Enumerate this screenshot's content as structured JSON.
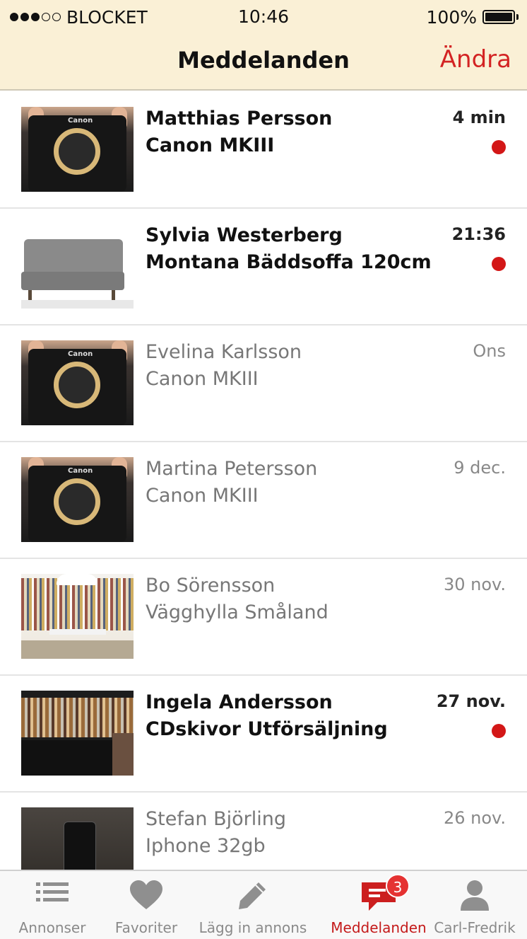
{
  "status_bar": {
    "carrier": "BLOCKET",
    "time": "10:46",
    "battery": "100%"
  },
  "nav": {
    "title": "Meddelanden",
    "edit_label": "Ändra"
  },
  "messages": [
    {
      "name": "Matthias Persson",
      "item": "Canon MKIII",
      "date": "4 min",
      "unread": true
    },
    {
      "name": "Sylvia Westerberg",
      "item": "Montana Bäddsoffa 120cm",
      "date": "21:36",
      "unread": true
    },
    {
      "name": "Evelina Karlsson",
      "item": "Canon MKIII",
      "date": "Ons",
      "unread": false
    },
    {
      "name": "Martina Petersson",
      "item": "Canon MKIII",
      "date": "9 dec.",
      "unread": false
    },
    {
      "name": "Bo Sörensson",
      "item": "Vägghylla Småland",
      "date": "30 nov.",
      "unread": false
    },
    {
      "name": "Ingela Andersson",
      "item": "CDskivor Utförsäljning",
      "date": "27 nov.",
      "unread": true
    },
    {
      "name": "Stefan Björling",
      "item": "Iphone 32gb",
      "date": "26 nov.",
      "unread": false
    }
  ],
  "tabs": [
    {
      "label": "Annonser",
      "icon": "list-icon"
    },
    {
      "label": "Favoriter",
      "icon": "heart-icon"
    },
    {
      "label": "Lägg in annons",
      "icon": "pencil-icon"
    },
    {
      "label": "Meddelanden",
      "icon": "chat-icon",
      "badge": "3",
      "active": true
    },
    {
      "label": "Carl-Fredrik",
      "icon": "person-icon"
    }
  ],
  "colors": {
    "accent": "#d32323",
    "header_bg": "#faf0d6",
    "unread_dot": "#d31717"
  }
}
